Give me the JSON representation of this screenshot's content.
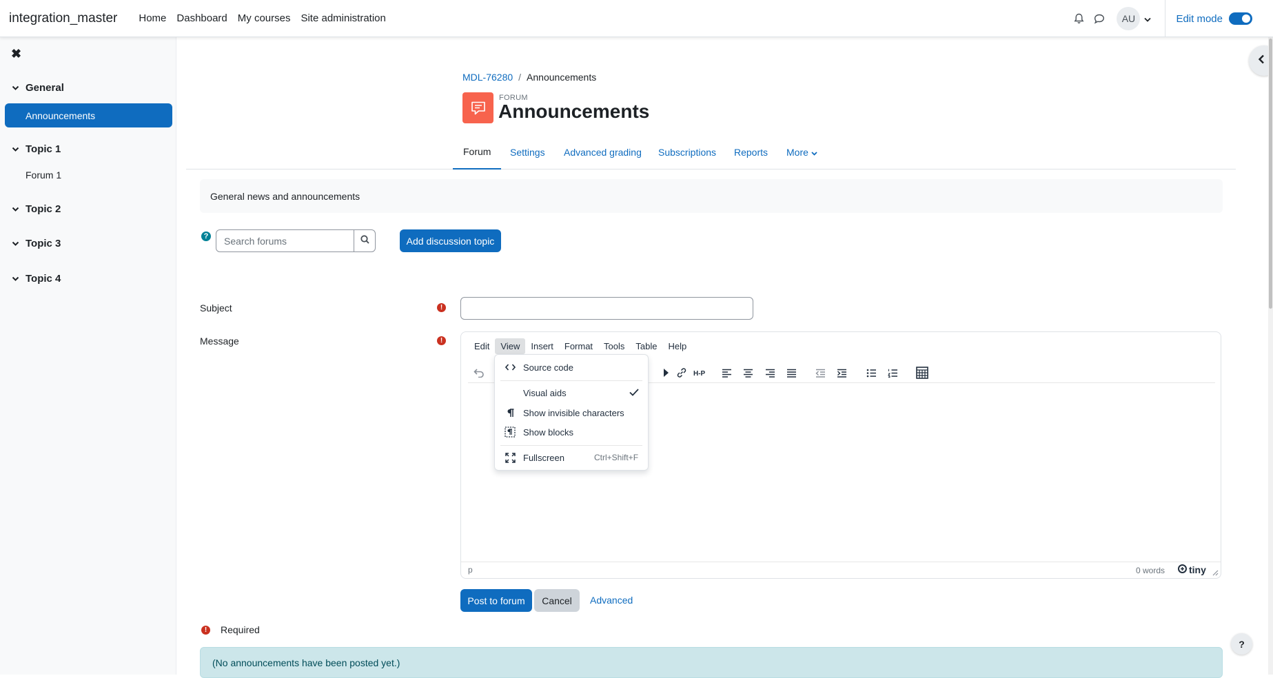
{
  "navbar": {
    "brand": "integration_master",
    "links": [
      "Home",
      "Dashboard",
      "My courses",
      "Site administration"
    ],
    "avatar_initials": "AU",
    "edit_mode_label": "Edit mode",
    "edit_mode_on": true
  },
  "drawer": {
    "close_glyph": "✖",
    "sections": [
      {
        "title": "General",
        "items": [
          "Announcements"
        ]
      },
      {
        "title": "Topic 1",
        "items": [
          "Forum 1"
        ]
      },
      {
        "title": "Topic 2",
        "items": []
      },
      {
        "title": "Topic 3",
        "items": []
      },
      {
        "title": "Topic 4",
        "items": []
      }
    ],
    "active_item": "Announcements"
  },
  "breadcrumb": {
    "course": "MDL-76280",
    "current": "Announcements"
  },
  "header": {
    "activity_type": "FORUM",
    "title": "Announcements"
  },
  "secondary_nav": {
    "tabs": [
      "Forum",
      "Settings",
      "Advanced grading",
      "Subscriptions",
      "Reports",
      "More"
    ],
    "active": "Forum"
  },
  "intro": "General news and announcements",
  "search": {
    "placeholder": "Search forums"
  },
  "add_topic_label": "Add discussion topic",
  "form": {
    "subject_label": "Subject",
    "message_label": "Message",
    "required_glyph": "!"
  },
  "editor": {
    "menus": [
      "Edit",
      "View",
      "Insert",
      "Format",
      "Tools",
      "Table",
      "Help"
    ],
    "open_menu": "View",
    "status_path": "p",
    "word_count": "0 words",
    "brand": "tiny"
  },
  "view_menu": {
    "items": [
      {
        "label": "Source code",
        "icon": "source-code-icon"
      },
      {
        "label": "Visual aids",
        "icon": "",
        "checked": true
      },
      {
        "label": "Show invisible characters",
        "icon": "pilcrow-icon"
      },
      {
        "label": "Show blocks",
        "icon": "show-blocks-icon"
      },
      {
        "label": "Fullscreen",
        "icon": "fullscreen-icon",
        "shortcut": "Ctrl+Shift+F"
      }
    ]
  },
  "buttons": {
    "post": "Post to forum",
    "cancel": "Cancel",
    "advanced": "Advanced"
  },
  "required_note": "Required",
  "alert": "(No announcements have been posted yet.)",
  "help_fab": "?",
  "colors": {
    "primary": "#0f6cbf",
    "forum_icon": "#f7634d",
    "required": "#ca3120",
    "info_bg": "#cce6ea"
  }
}
